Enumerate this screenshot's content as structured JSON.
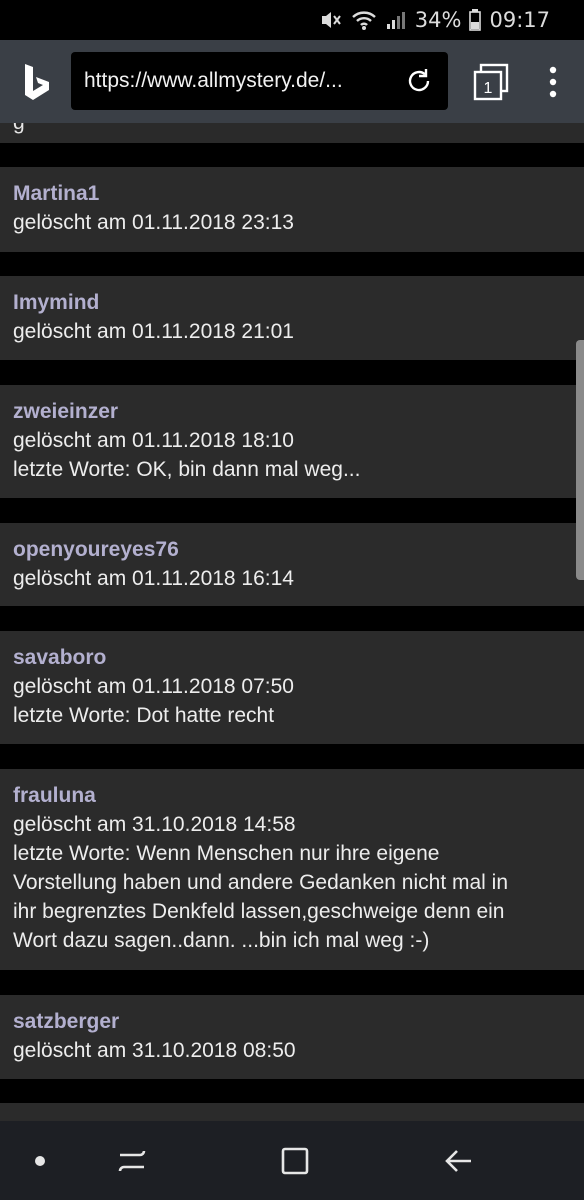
{
  "status": {
    "battery": "34%",
    "time": "09:17"
  },
  "browser": {
    "url": "https://www.allmystery.de/...",
    "tab_count": "1"
  },
  "top_partial": "g",
  "entries": [
    {
      "user": "Martina1",
      "deleted": "gelöscht am 01.11.2018 23:13"
    },
    {
      "user": "Imymind",
      "deleted": "gelöscht am 01.11.2018 21:01"
    },
    {
      "user": "zweieinzer",
      "deleted": "gelöscht am 01.11.2018 18:10",
      "last": "letzte Worte: OK, bin dann mal weg..."
    },
    {
      "user": "openyoureyes76",
      "deleted": "gelöscht am 01.11.2018 16:14"
    },
    {
      "user": "savaboro",
      "deleted": "gelöscht am 01.11.2018 07:50",
      "last": "letzte Worte: Dot hatte recht"
    },
    {
      "user": "frauluna",
      "deleted": "gelöscht am 31.10.2018 14:58",
      "last_lines": [
        "letzte Worte: Wenn Menschen nur ihre eigene",
        "Vorstellung haben und andere Gedanken nicht mal in",
        "ihr begrenztes Denkfeld lassen,geschweige denn ein",
        "Wort dazu sagen..dann. ...bin ich mal weg :-)"
      ]
    },
    {
      "user": "satzberger",
      "deleted": "gelöscht am 31.10.2018 08:50"
    }
  ]
}
